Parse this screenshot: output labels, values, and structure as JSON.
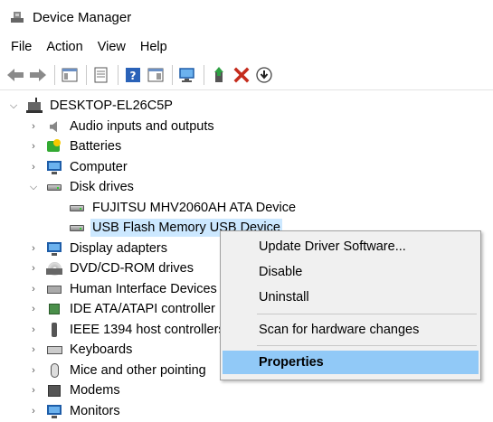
{
  "window": {
    "title": "Device Manager"
  },
  "menu": [
    "File",
    "Action",
    "View",
    "Help"
  ],
  "icons": {
    "back": "back-arrow-icon",
    "forward": "forward-arrow-icon",
    "properties": "properties-icon",
    "help": "help-icon",
    "scan": "scan-hardware-icon",
    "update": "update-driver-icon",
    "uninstall": "uninstall-x-icon",
    "download": "download-icon"
  },
  "colors": {
    "selection": "#cce8ff",
    "menu_highlight": "#91c9f7",
    "uninstall_red": "#c42b1c"
  },
  "tree": {
    "root": "DESKTOP-EL26C5P",
    "items": [
      {
        "label": "Audio inputs and outputs",
        "icon": "speaker-icon",
        "expanded": false
      },
      {
        "label": "Batteries",
        "icon": "battery-icon",
        "expanded": false
      },
      {
        "label": "Computer",
        "icon": "monitor-icon",
        "expanded": false
      },
      {
        "label": "Disk drives",
        "icon": "disk-drive-icon",
        "expanded": true
      },
      {
        "label": "FUJITSU MHV2060AH ATA Device",
        "icon": "disk-drive-icon",
        "child": true
      },
      {
        "label": "USB Flash Memory USB Device",
        "icon": "disk-drive-icon",
        "child": true,
        "selected": true
      },
      {
        "label": "Display adapters",
        "icon": "monitor-icon",
        "expanded": false
      },
      {
        "label": "DVD/CD-ROM drives",
        "icon": "disc-icon",
        "expanded": false
      },
      {
        "label": "Human Interface Devices",
        "icon": "hid-icon",
        "expanded": false
      },
      {
        "label": "IDE ATA/ATAPI controller",
        "icon": "chip-icon",
        "expanded": false
      },
      {
        "label": "IEEE 1394 host controllers",
        "icon": "plug-icon",
        "expanded": false
      },
      {
        "label": "Keyboards",
        "icon": "keyboard-icon",
        "expanded": false
      },
      {
        "label": "Mice and other pointing",
        "icon": "mouse-icon",
        "expanded": false
      },
      {
        "label": "Modems",
        "icon": "modem-icon",
        "expanded": false
      },
      {
        "label": "Monitors",
        "icon": "monitor-icon",
        "expanded": false
      }
    ]
  },
  "context_menu": {
    "update": "Update Driver Software...",
    "disable": "Disable",
    "uninstall": "Uninstall",
    "scan": "Scan for hardware changes",
    "properties": "Properties"
  }
}
